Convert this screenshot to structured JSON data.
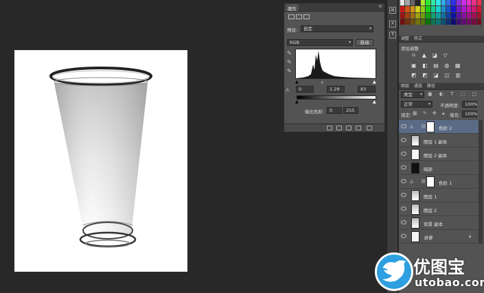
{
  "properties": {
    "tab_label": "属性",
    "preset_label": "预设:",
    "preset_value": "自定",
    "channel_value": "RGB",
    "auto_label": "自动",
    "input_black": "0",
    "input_gamma": "1.29",
    "input_white": "83",
    "output_label": "输出色阶:",
    "output_black": "0",
    "output_white": "255"
  },
  "strip": {
    "icon_a": "A",
    "icon_para": "¶"
  },
  "adjust": {
    "tab_1": "调整",
    "tab_2": "样式",
    "title": "添加调整",
    "row1": "☼ ▲ ◪ ▽",
    "row2": "▣ ◧ ▤ ◍ ▦",
    "row3": "◩ ◩ ◪ ◫ ▥"
  },
  "layers": {
    "tab_1": "图层",
    "tab_2": "通道",
    "tab_3": "路径",
    "filter_label": "类型",
    "blend_mode": "正常",
    "opacity_label": "不透明度:",
    "opacity_value": "100%",
    "lock_label": "锁定:",
    "fill_label": "填充:",
    "fill_value": "100%",
    "items": [
      {
        "name": "色阶 2",
        "selected": true,
        "type": "adjustment"
      },
      {
        "name": "图层 1 副本",
        "selected": false,
        "type": "pixel"
      },
      {
        "name": "图层 2 副本",
        "selected": false,
        "type": "pixel"
      },
      {
        "name": "暗部",
        "selected": false,
        "type": "dark"
      },
      {
        "name": "色阶 1",
        "selected": false,
        "type": "adjustment"
      },
      {
        "name": "图层 1",
        "selected": false,
        "type": "pixel"
      },
      {
        "name": "图层 2",
        "selected": false,
        "type": "pixel"
      },
      {
        "name": "背景 副本",
        "selected": false,
        "type": "pixel"
      },
      {
        "name": "背景",
        "selected": false,
        "type": "background"
      }
    ]
  },
  "watermark": {
    "brand": "优图宝",
    "url": "utobao.com"
  },
  "colors": {
    "app_bg": "#282828",
    "panel_bg": "#535353",
    "selected_layer": "#5a6b86",
    "watermark_blue": "#2e9fe0"
  }
}
